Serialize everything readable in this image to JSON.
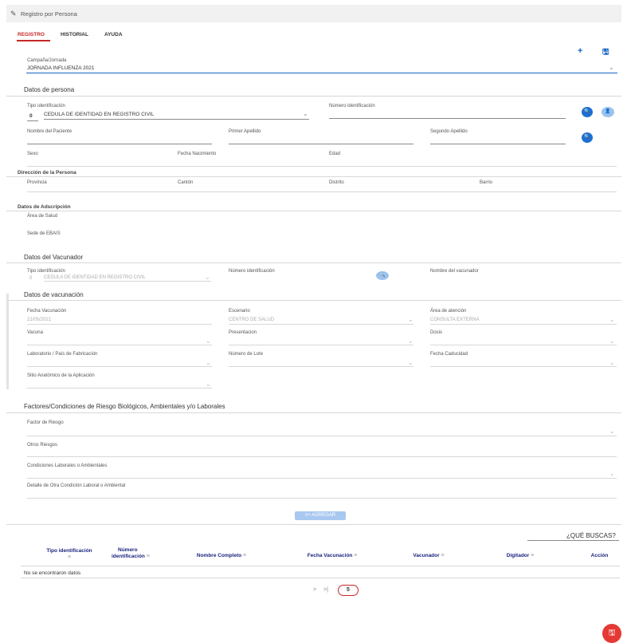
{
  "window": {
    "title": "Registro por Persona"
  },
  "tabs": [
    {
      "label": "REGISTRO",
      "active": true
    },
    {
      "label": "HISTORIAL",
      "active": false
    },
    {
      "label": "AYUDA",
      "active": false
    }
  ],
  "toolbar": {
    "add_icon": "plus-icon",
    "save_icon": "floppy-disk-icon"
  },
  "campaign": {
    "label": "Campaña/Jornada",
    "value": "JORNADA INFLUENZA 2021"
  },
  "persona": {
    "section": "Datos de persona",
    "tipo_label": "Tipo identificación",
    "tipo_code": "0",
    "tipo_value": "CEDULA DE IDENTIDAD EN REGISTRO CIVIL",
    "numero_label": "Número identificación",
    "nombre_label": "Nombre del Paciente",
    "primer_label": "Primer Apellido",
    "segundo_label": "Segundo Apellido",
    "sexo_label": "Sexo",
    "fecha_nac_label": "Fecha Nacimiento",
    "edad_label": "Edad"
  },
  "direccion": {
    "section": "Dirección de la Persona",
    "provincia": "Provincia",
    "canton": "Cantón",
    "distrito": "Distrito",
    "barrio": "Barrio"
  },
  "adscripcion": {
    "section": "Datos de Adscripción",
    "area": "Área de Salud",
    "sede": "Sede de EBAIS"
  },
  "vacunador": {
    "section": "Datos del Vacunador",
    "tipo_label": "Tipo identificación",
    "tipo_code": "0",
    "tipo_value": "CEDULA DE IDENTIDAD EN REGISTRO CIVIL",
    "numero_label": "Número identificación",
    "nombre_label": "Nombre del vacunador"
  },
  "vacunacion": {
    "section": "Datos de vacunación",
    "fecha_label": "Fecha Vacunación",
    "fecha_value": "21/05/2021",
    "escenario_label": "Escenario",
    "escenario_value": "CENTRO DE SALUD",
    "area_label": "Área de atención",
    "area_value": "CONSULTA EXTERNA",
    "vacuna_label": "Vacuna",
    "presentacion_label": "Presentacion",
    "dosis_label": "Dosis",
    "laboratorio_label": "Laboratorio / País de Fabricación",
    "lote_label": "Número de Lote",
    "caducidad_label": "Fecha Caducidad",
    "sitio_label": "Sitio Anatómico de la Aplicación"
  },
  "riesgos": {
    "section": "Factores/Condiciones de Riesgo Biológicos, Ambientales y/o Laborales",
    "factor_label": "Factor de Riesgo",
    "otros_label": "Otros Riesgos",
    "condiciones_label": "Condiciones Laborales o Ambientales",
    "detalle_label": "Detalle de Otra Condición Laboral o Ambiental",
    "agregar_label": "AGREGAR"
  },
  "table": {
    "search_label": "¿QUÉ BUSCAS?",
    "headers": [
      {
        "l1": "Tipo identificación",
        "l2": ""
      },
      {
        "l1": "Número",
        "l2": "identificación"
      },
      {
        "l1": "Nombre Completo",
        "l2": ""
      },
      {
        "l1": "Fecha Vacunación",
        "l2": ""
      },
      {
        "l1": "Vacunador",
        "l2": ""
      },
      {
        "l1": "Digitador",
        "l2": ""
      },
      {
        "l1": "Acción",
        "l2": ""
      }
    ],
    "empty_text": "No se encontraron datos",
    "pager": {
      "next": ">",
      "last": ">|",
      "page_size": "5"
    }
  }
}
